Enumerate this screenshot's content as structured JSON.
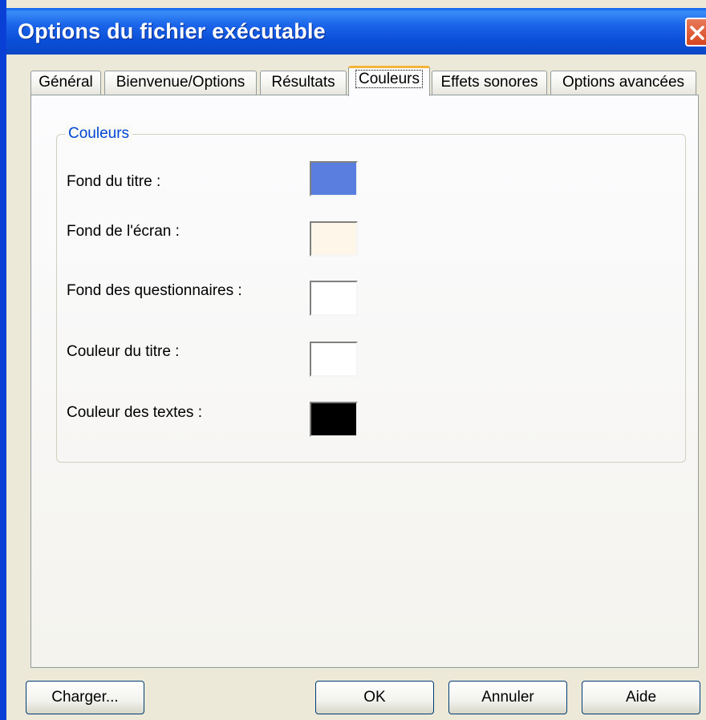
{
  "window": {
    "title": "Options du fichier exécutable"
  },
  "tabs": [
    {
      "label": "Général"
    },
    {
      "label": "Bienvenue/Options"
    },
    {
      "label": "Résultats"
    },
    {
      "label": "Couleurs"
    },
    {
      "label": "Effets sonores"
    },
    {
      "label": "Options avancées"
    }
  ],
  "active_tab": "Couleurs",
  "group": {
    "legend": "Couleurs",
    "rows": [
      {
        "label": "Fond du titre :",
        "color": "#5a7ee0"
      },
      {
        "label": "Fond de l'écran :",
        "color": "#fdf6e9"
      },
      {
        "label": "Fond des questionnaires :",
        "color": "#ffffff"
      },
      {
        "label": "Couleur du titre :",
        "color": "#ffffff"
      },
      {
        "label": "Couleur des textes :",
        "color": "#000000"
      }
    ]
  },
  "buttons": {
    "load": "Charger...",
    "ok": "OK",
    "cancel": "Annuler",
    "help": "Aide"
  },
  "icons": {
    "close": "close-icon"
  },
  "colors": {
    "titlebar": "#0a4fd8",
    "active_tab_accent": "#f5b338",
    "legend": "#0046d5"
  }
}
